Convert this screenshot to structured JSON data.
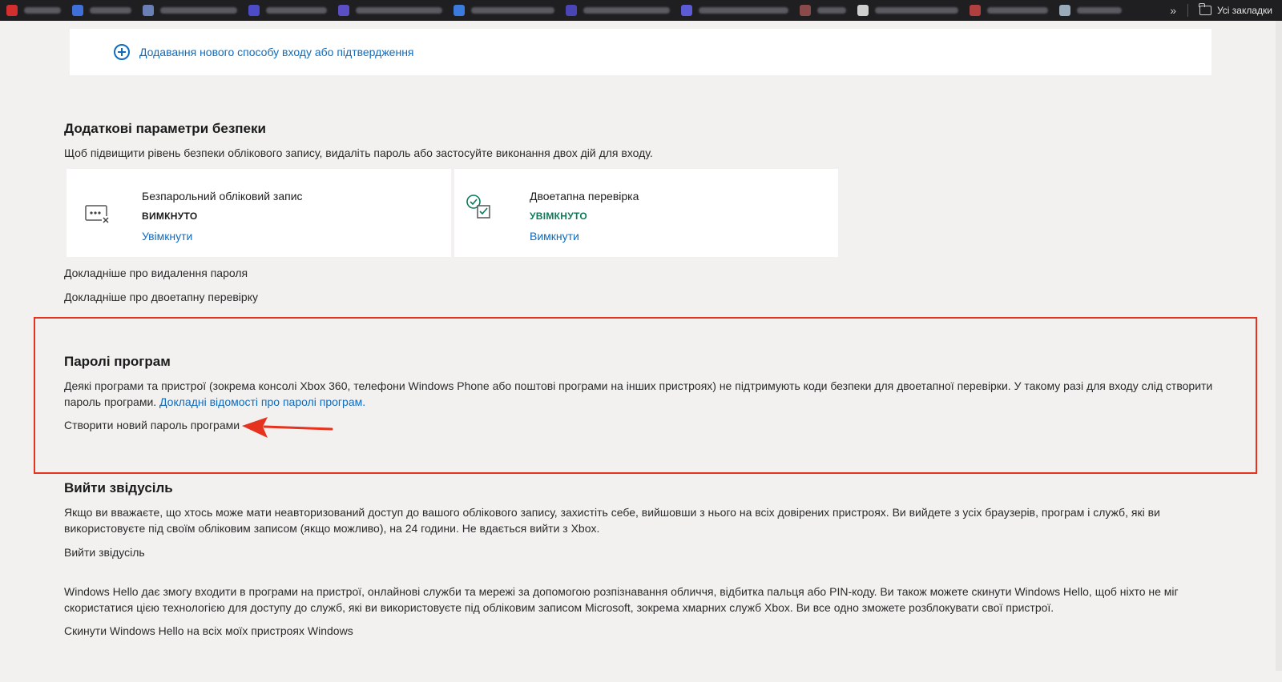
{
  "bookmarks_bar": {
    "more_label": "»",
    "all_bookmarks_label": "Усі закладки",
    "favicon_colors": [
      "#d32f2f",
      "#3f6fd8",
      "#6a7fb5",
      "#4c4cc9",
      "#5b4fc7",
      "#3b7bde",
      "#4a45b5",
      "#5b5bd6",
      "#8a4a4a",
      "#cfcfcf",
      "#b04040",
      "#9ab"
    ]
  },
  "add_method": {
    "label": "Додавання нового способу входу або підтвердження"
  },
  "additional_security": {
    "title": "Додаткові параметри безпеки",
    "description": "Щоб підвищити рівень безпеки облікового запису, видаліть пароль або застосуйте виконання двох дій для входу.",
    "cards": [
      {
        "icon": "passwordless-icon",
        "title": "Безпарольний обліковий запис",
        "status": "ВИМКНУТО",
        "status_color": "#1b1b1b",
        "action": "Увімкнути"
      },
      {
        "icon": "two-step-icon",
        "title": "Двоетапна перевірка",
        "status": "УВІМКНУТО",
        "status_color": "#0c7a5a",
        "action": "Вимкнути"
      }
    ],
    "links": [
      "Докладніше про видалення пароля",
      "Докладніше про двоетапну перевірку"
    ]
  },
  "app_passwords": {
    "title": "Паролі програм",
    "description_line1": "Деякі програми та пристрої (зокрема консолі Xbox 360, телефони Windows Phone або поштові програми на інших пристроях) не підтримують коди безпеки для двоетапної перевірки. У такому разі для входу слід створити",
    "description_line2_prefix": "пароль програми.",
    "description_link": "Докладні відомості про паролі програм.",
    "create_link": "Створити новий пароль програми"
  },
  "sign_out_everywhere": {
    "title": "Вийти звідусіль",
    "description_line1": "Якщо ви вважаєте, що хтось може мати неавторизований доступ до вашого облікового запису, захистіть себе, вийшовши з нього на всіх довірених пристроях. Ви вийдете з усіх браузерів, програм і служб, які ви",
    "description_line2": "використовуєте під своїм обліковим записом (якщо можливо), на 24 години. Не вдається вийти з Xbox.",
    "link": "Вийти звідусіль"
  },
  "windows_hello": {
    "description_line1": "Windows Hello дає змогу входити в програми на пристрої, онлайнові служби та мережі за допомогою розпізнавання обличчя, відбитка пальця або PIN-коду. Ви також можете скинути Windows Hello, щоб ніхто не міг",
    "description_line2": "скористатися цією технологією для доступу до служб, які ви використовуєте під обліковим записом Microsoft, зокрема хмарних служб Xbox. Ви все одно зможете розблокувати свої пристрої.",
    "link": "Скинути Windows Hello на всіх моїх пристроях Windows"
  },
  "colors": {
    "link": "#0f6cbd",
    "highlight": "#e5331f",
    "background": "#f2f1f0"
  }
}
